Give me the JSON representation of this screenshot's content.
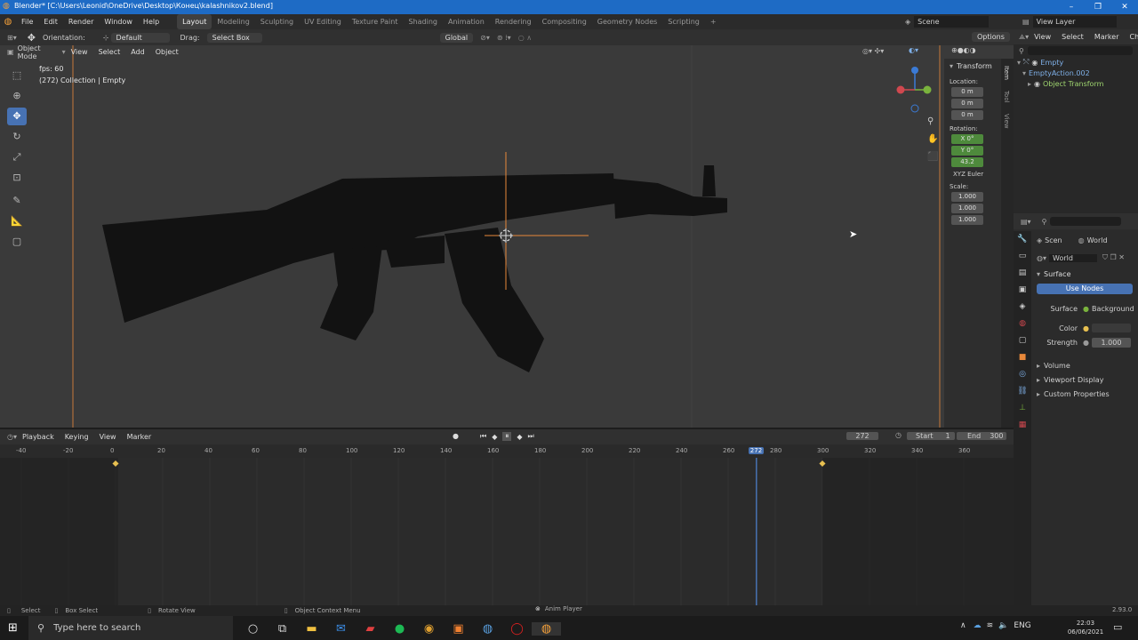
{
  "window": {
    "title": "Blender* [C:\\Users\\Leonid\\OneDrive\\Desktop\\Конец\\kalashnikov2.blend]",
    "controls": [
      "–",
      "❐",
      "✕"
    ]
  },
  "menubar": {
    "menus": [
      "File",
      "Edit",
      "Render",
      "Window",
      "Help"
    ],
    "workspaces": [
      "Layout",
      "Modeling",
      "Sculpting",
      "UV Editing",
      "Texture Paint",
      "Shading",
      "Animation",
      "Rendering",
      "Compositing",
      "Geometry Nodes",
      "Scripting"
    ],
    "add_workspace": "+",
    "scene_label": "Scene",
    "view_layer_label": "View Layer"
  },
  "header": {
    "orientation_label": "Orientation:",
    "orientation_value": "Default",
    "drag_label": "Drag:",
    "drag_value": "Select Box",
    "transform_orientation": "Global",
    "options_label": "Options"
  },
  "viewport": {
    "mode": "Object Mode",
    "menus": [
      "View",
      "Select",
      "Add",
      "Object"
    ],
    "overlay_fps": "fps: 60",
    "overlay_collection": "(272) Collection | Empty"
  },
  "npanel": {
    "tabs": [
      "Item",
      "Tool",
      "View"
    ],
    "section_title": "Transform",
    "location_label": "Location:",
    "location": [
      "0 m",
      "0 m",
      "0 m"
    ],
    "rotation_label": "Rotation:",
    "rotation": [
      "X  0°",
      "Y  0°",
      "43.2"
    ],
    "rotation_mode": "XYZ Euler",
    "scale_label": "Scale:",
    "scale": [
      "1.000",
      "1.000",
      "1.000"
    ]
  },
  "outliner": {
    "menus": [
      "View",
      "Select",
      "Marker",
      "Cha"
    ],
    "items": [
      {
        "label": "Empty",
        "color": "#7fb0e8"
      },
      {
        "label": "EmptyAction.002",
        "color": "#7fb0e8"
      },
      {
        "label": "Object Transform",
        "color": "#9fd56f"
      }
    ]
  },
  "properties": {
    "tabs": [
      "Scen",
      "World"
    ],
    "world_name": "World",
    "surface_section": "Surface",
    "use_nodes_label": "Use Nodes",
    "surface_label": "Surface",
    "surface_value": "Background",
    "color_label": "Color",
    "strength_label": "Strength",
    "strength_value": "1.000",
    "sections": [
      "Volume",
      "Viewport Display",
      "Custom Properties"
    ]
  },
  "timeline": {
    "menus": [
      "Playback",
      "Keying",
      "View",
      "Marker"
    ],
    "current_frame": "272",
    "start_label": "Start",
    "start_value": "1",
    "end_label": "End",
    "end_value": "300",
    "ruler_ticks": [
      "-40",
      "-20",
      "0",
      "20",
      "40",
      "60",
      "80",
      "100",
      "120",
      "140",
      "160",
      "180",
      "200",
      "220",
      "240",
      "260",
      "272",
      "280",
      "300",
      "320",
      "340",
      "360"
    ],
    "playhead_label": "272",
    "keyframe_frames": [
      0,
      300
    ]
  },
  "statusbar": {
    "items": [
      "Select",
      "Box Select",
      "Rotate View",
      "Object Context Menu"
    ],
    "playing": "Anim Player",
    "version": "2.93.0"
  },
  "taskbar": {
    "search_placeholder": "Type here to search",
    "language": "ENG",
    "time": "22:03",
    "date": "06/06/2021"
  },
  "colors": {
    "accent_blue": "#4772b3",
    "titlebar_blue": "#1e6bc5",
    "selection_orange": "#e8883a",
    "keyframe_yellow": "#e8c050"
  }
}
